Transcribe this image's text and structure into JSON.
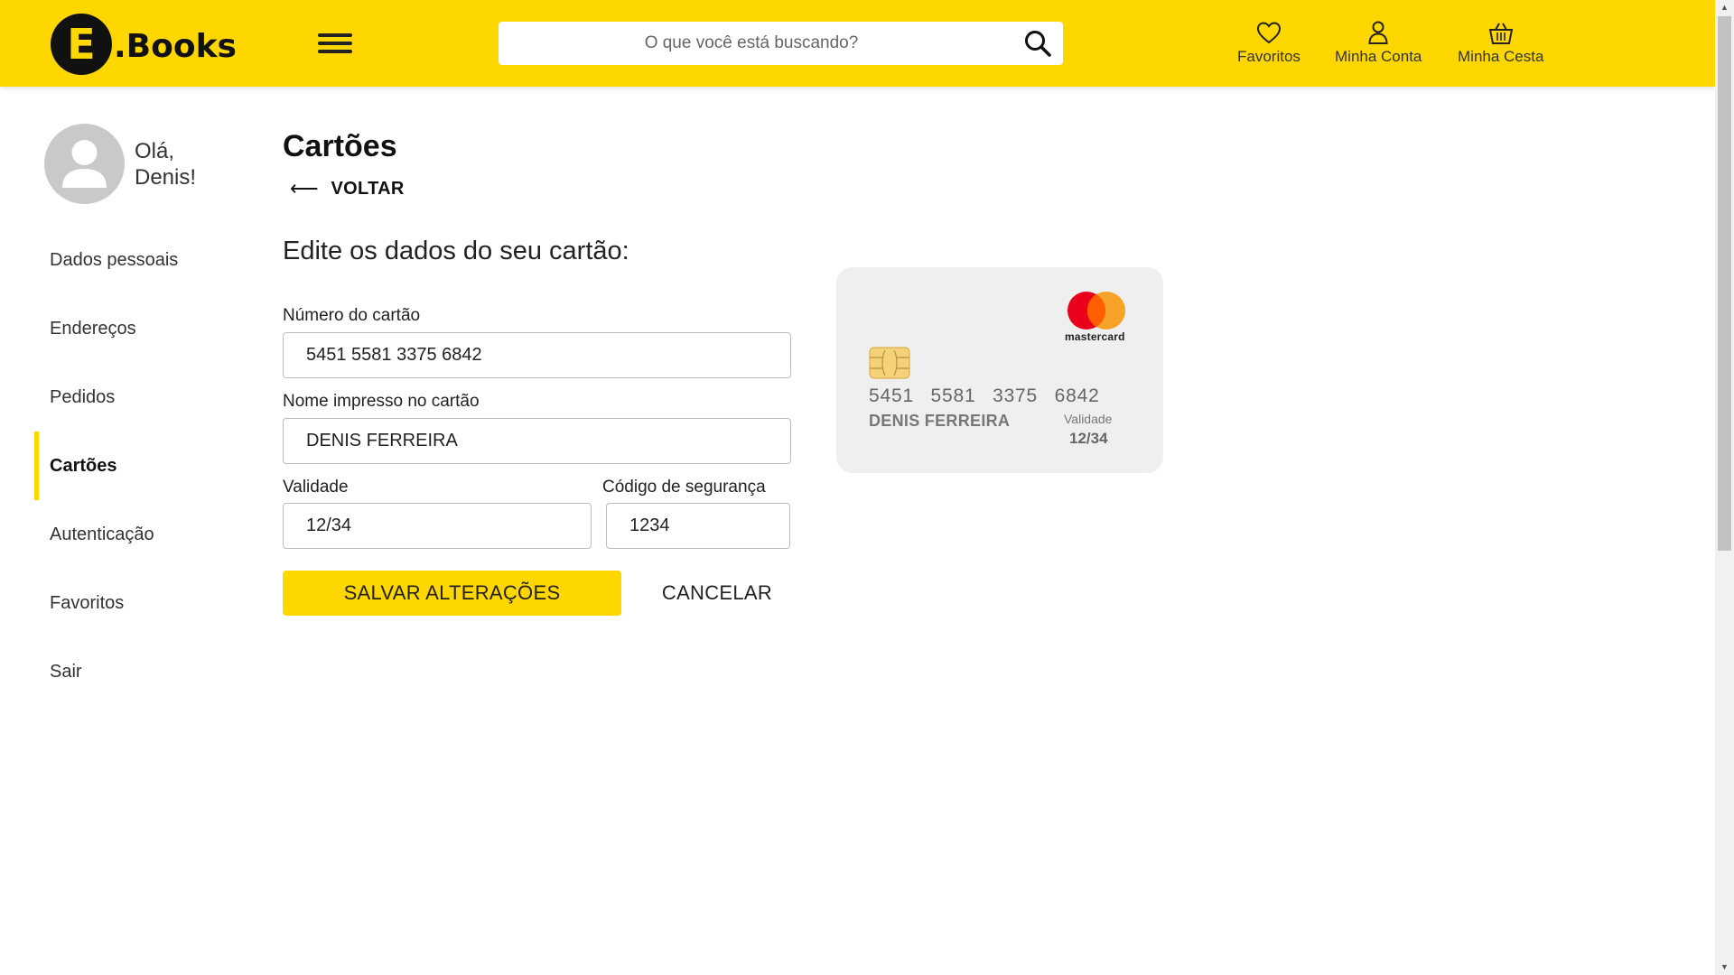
{
  "header": {
    "logo_letter": "E",
    "logo_text": ".Books",
    "search_placeholder": "O que você está buscando?",
    "favorites_label": "Favoritos",
    "account_label": "Minha Conta",
    "basket_label": "Minha Cesta"
  },
  "sidebar": {
    "greeting_hello": "Olá,",
    "greeting_name": "Denis!",
    "items": [
      {
        "label": "Dados pessoais"
      },
      {
        "label": "Endereços"
      },
      {
        "label": "Pedidos"
      },
      {
        "label": "Cartões"
      },
      {
        "label": "Autenticação"
      },
      {
        "label": "Favoritos"
      },
      {
        "label": "Sair"
      }
    ]
  },
  "main": {
    "title": "Cartões",
    "back_label": "VOLTAR",
    "form_heading": "Edite os dados do seu cartão:",
    "card_number_label": "Número do cartão",
    "card_number_value": "5451 5581 3375 6842",
    "card_name_label": "Nome impresso no cartão",
    "card_name_value": "DENIS FERREIRA",
    "expiry_label": "Validade",
    "expiry_value": "12/34",
    "cvv_label": "Código de segurança",
    "cvv_value": "1234",
    "save_label": "SALVAR ALTERAÇÕES",
    "cancel_label": "CANCELAR"
  },
  "card_preview": {
    "brand": "mastercard",
    "number": "5451 5581 3375 6842",
    "holder": "DENIS FERREIRA",
    "valid_label": "Validade",
    "valid_value": "12/34"
  },
  "colors": {
    "accent": "#FFD700",
    "mc_red": "#EB001B",
    "mc_orange": "#F79E1B"
  }
}
